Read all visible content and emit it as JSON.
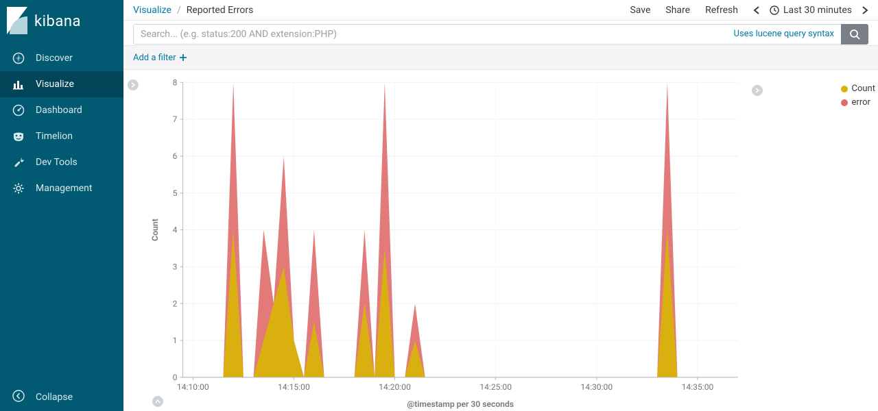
{
  "brand": "kibana",
  "sidebar": {
    "items": [
      {
        "label": "Discover",
        "icon": "compass-icon"
      },
      {
        "label": "Visualize",
        "icon": "chart-bar-icon",
        "active": true
      },
      {
        "label": "Dashboard",
        "icon": "gauge-icon"
      },
      {
        "label": "Timelion",
        "icon": "mask-icon"
      },
      {
        "label": "Dev Tools",
        "icon": "wrench-icon"
      },
      {
        "label": "Management",
        "icon": "gear-icon"
      }
    ],
    "collapse_label": "Collapse"
  },
  "breadcrumb": {
    "root": "Visualize",
    "sep": "/",
    "current": "Reported Errors"
  },
  "actions": {
    "save": "Save",
    "share": "Share",
    "refresh": "Refresh",
    "time_range": "Last 30 minutes"
  },
  "search": {
    "placeholder": "Search... (e.g. status:200 AND extension:PHP)",
    "lucene_hint": "Uses lucene query syntax"
  },
  "filter_bar": {
    "add_filter": "Add a filter"
  },
  "legend": {
    "series": [
      {
        "name": "Count",
        "color": "#d9b20b"
      },
      {
        "name": "error",
        "color": "#e06c6c"
      }
    ]
  },
  "chart_data": {
    "type": "area",
    "ylabel": "Count",
    "xlabel": "@timestamp per 30 seconds",
    "ylim": [
      0,
      8
    ],
    "y_ticks": [
      0,
      1,
      2,
      3,
      4,
      5,
      6,
      7,
      8
    ],
    "x_tick_labels": [
      "14:10:00",
      "14:15:00",
      "14:20:00",
      "14:25:00",
      "14:30:00",
      "14:35:00"
    ],
    "n_slots": 56,
    "x_tick_slots": [
      1,
      11,
      21,
      31,
      41,
      51
    ],
    "series": [
      {
        "name": "Count",
        "color": "#d9b20b",
        "values": [
          0,
          0,
          0,
          0,
          0,
          4,
          0,
          0,
          1,
          2,
          3,
          1,
          0,
          1.5,
          0,
          0,
          0,
          0,
          2,
          0,
          3.5,
          0,
          0,
          1,
          0,
          0,
          0,
          0,
          0,
          0,
          0,
          0,
          0,
          0,
          0,
          0,
          0,
          0,
          0,
          0,
          0,
          0,
          0,
          0,
          0,
          0,
          0,
          0,
          4,
          0,
          0,
          0,
          0,
          0,
          0,
          0
        ]
      },
      {
        "name": "error",
        "color": "#e06c6c",
        "values": [
          0,
          0,
          0,
          0,
          0,
          8,
          0,
          0,
          4,
          2,
          6,
          1,
          0,
          4,
          0,
          0,
          0,
          0,
          4,
          0,
          8,
          0,
          0,
          2,
          0,
          0,
          0,
          0,
          0,
          0,
          0,
          0,
          0,
          0,
          0,
          0,
          0,
          0,
          0,
          0,
          0,
          0,
          0,
          0,
          0,
          0,
          0,
          0,
          8,
          0,
          0,
          0,
          0,
          0,
          0,
          0
        ]
      }
    ]
  }
}
